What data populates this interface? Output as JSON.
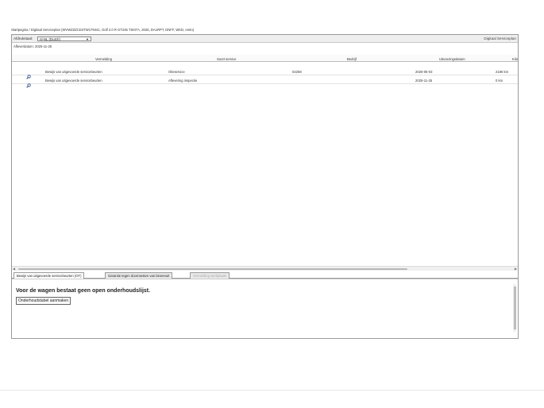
{
  "breadcrumb": "Startpagina / Digitaal Serviceplan (WVWZZZCD4TW179441, Golf 2.0 R GT245 TSI07A, 2026, DA1RPT, DNFF, WKD, erelo)",
  "toolbar": {
    "label": "Afdrukstaal:",
    "select_value": "nl-NL (Dutch)",
    "title": "Digitaal Serviceplan"
  },
  "afleverdatum": "Afleverdatum: 2025-11-25",
  "table": {
    "columns": [
      "Vermelding",
      "Soort service",
      "Bedrijf",
      "Uitvoeringsdatum",
      "Kilo"
    ],
    "rows": [
      {
        "vermelding": "Bewijs van uitgevoerde servicebeurten",
        "soort": "Olieservice",
        "bedrijf": "02258",
        "datum": "2026-06-03",
        "km": "2186 km"
      },
      {
        "vermelding": "Bewijs van uitgevoerde servicebeurten",
        "soort": "Aflevering inspectie",
        "bedrijf": "",
        "datum": "2025-11-25",
        "km": "0 km"
      }
    ]
  },
  "tabs": [
    {
      "label": "Bewijs van uitgevoerde servicebeurten (OT)",
      "state": "active"
    },
    {
      "label": "Garantie tegen doorroesten van binnenuit",
      "state": "normal"
    },
    {
      "label": "Vermelding werkplaats",
      "state": "disabled"
    }
  ],
  "panel": {
    "message": "Voor de wagen bestaat geen open onderhoudslijst.",
    "button_label": "Onderhoudstabel aanmaken"
  },
  "icons": {
    "row_action": "magnifier-icon",
    "scroll_left": "arrow-left-icon",
    "scroll_right": "arrow-right-icon",
    "dropdown": "chevron-down-icon"
  }
}
